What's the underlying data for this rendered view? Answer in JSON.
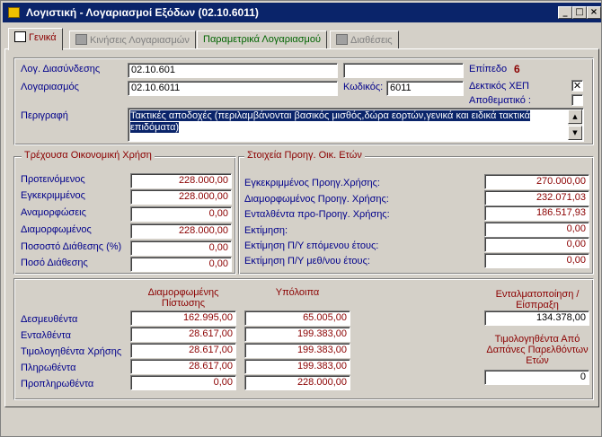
{
  "window": {
    "title": "Λογιστική - Λογαριασμοί Εξόδων (02.10.6011)",
    "min": "_",
    "max": "□",
    "close": "×"
  },
  "tabs": [
    {
      "label": "Γενικά"
    },
    {
      "label": "Κινήσεις Λογαριασμών"
    },
    {
      "label": "Παραμετρικά Λογαριασμού"
    },
    {
      "label": "Διαθέσεις"
    }
  ],
  "general": {
    "link_label": "Λογ. Διασύνδεσης",
    "link_value": "02.10.601",
    "link_extra": "",
    "account_label": "Λογαριασμός",
    "account_value": "02.10.6011",
    "code_label": "Κωδικός:",
    "code_value": "6011",
    "level_label": "Επίπεδο",
    "level_value": "6",
    "xep_label": "Δεκτικός ΧΕΠ",
    "xep_checked": "✕",
    "reserve_label": "Αποθεματικό :",
    "reserve_checked": "",
    "desc_label": "Περιγραφή",
    "desc_value": "Τακτικές αποδοχές (περιλαμβάνονται βασικός μισθός,δώρα εορτών,γενικά και ειδικά τακτικά επιδόματα)"
  },
  "current_year": {
    "title": "Τρέχουσα Οικονομική Χρήση",
    "rows": [
      {
        "label": "Προτεινόμενος",
        "value": "228.000,00"
      },
      {
        "label": "Εγκεκριμμένος",
        "value": "228.000,00"
      },
      {
        "label": "Αναμορφώσεις",
        "value": "0,00"
      },
      {
        "label": "Διαμορφωμένος",
        "value": "228.000,00"
      },
      {
        "label": "Ποσοστό Διάθεσης (%)",
        "value": "0,00"
      },
      {
        "label": "Ποσό Διάθεσης",
        "value": "0,00"
      }
    ]
  },
  "previous_years": {
    "title": "Στοιχεία Προηγ. Οικ. Ετών",
    "rows": [
      {
        "label": "Εγκεκριμμένος Προηγ.Χρήσης:",
        "value": "270.000,00"
      },
      {
        "label": "Διαμορφωμένος Προηγ. Χρήσης:",
        "value": "232.071,03"
      },
      {
        "label": "Ενταλθέντα προ-Προηγ. Χρήσης:",
        "value": "186.517,93"
      },
      {
        "label": "Εκτίμηση:",
        "value": "0,00"
      },
      {
        "label": "Εκτίμηση Π/Υ επόμενου έτους:",
        "value": "0,00"
      },
      {
        "label": "Εκτίμηση Π/Υ μεθ/νου έτους:",
        "value": "0,00"
      }
    ]
  },
  "summary": {
    "col1_header": "Διαμορφωμένης Πίστωσης",
    "col2_header": "Υπόλοιπα",
    "rows": [
      {
        "label": "Δεσμευθέντα",
        "v1": "162.995,00",
        "v2": "65.005,00"
      },
      {
        "label": "Ενταλθέντα",
        "v1": "28.617,00",
        "v2": "199.383,00"
      },
      {
        "label": "Τιμολογηθέντα Χρήσης",
        "v1": "28.617,00",
        "v2": "199.383,00"
      },
      {
        "label": "Πληρωθέντα",
        "v1": "28.617,00",
        "v2": "199.383,00"
      },
      {
        "label": "Προπληρωθέντα",
        "v1": "0,00",
        "v2": "228.000,00"
      }
    ],
    "entalm_label": "Ενταλματοποίηση / Είσπραξη",
    "entalm_value": "134.378,00",
    "prev_inv_label": "Τιμολογηθέντα Από Δαπάνες Παρελθόντων Ετών",
    "prev_inv_value": "0"
  }
}
